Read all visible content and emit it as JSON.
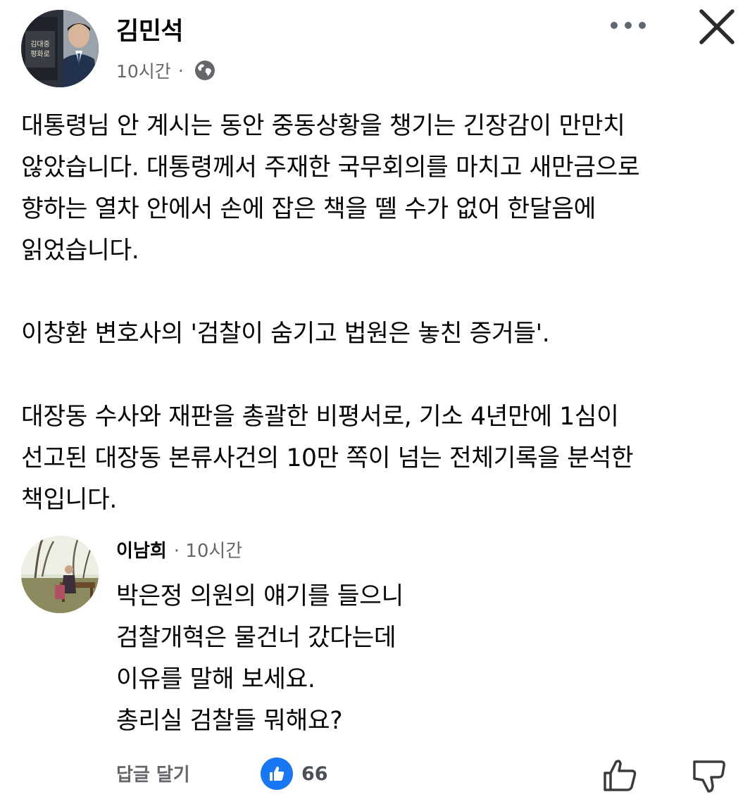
{
  "post": {
    "author": "김민석",
    "time": "10시간",
    "separator": "·",
    "privacy_icon": "globe-icon",
    "avatar_caption_line1": "김대중",
    "avatar_caption_line2": "평화로",
    "paragraphs": [
      [
        "대통령님 안 계시는 동안 중동상황을 챙기는 긴장감이 만만치",
        "않았습니다. 대통령께서 주재한 국무회의를 마치고 새만금으로",
        "향하는 열차 안에서 손에 잡은 책을 뗄 수가 없어 한달음에",
        "읽었습니다."
      ],
      [
        "이창환 변호사의 '검찰이 숨기고 법원은 놓친 증거들'."
      ],
      [
        "대장동 수사와 재판을 총괄한 비평서로, 기소 4년만에 1심이",
        "선고된 대장동 본류사건의 10만 쪽이 넘는 전체기록을 분석한",
        "책입니다."
      ]
    ]
  },
  "header_icons": {
    "more": "more-options-icon",
    "close": "close-icon"
  },
  "comment": {
    "author": "이남희",
    "time": "· 10시간",
    "lines": [
      "박은정 의원의 얘기를 들으니",
      "검찰개혁은 물건너 갔다는데",
      "이유를 말해 보세요.",
      "총리실 검찰들 뭐해요?"
    ],
    "reply_label": "답글 달기",
    "reaction_count": "66",
    "reaction_icon": "like-icon",
    "like_button_icon": "thumbs-up-icon",
    "dislike_button_icon": "thumbs-down-icon"
  },
  "colors": {
    "text": "#050505",
    "secondary_text": "#65676b",
    "like_blue": "#1877f2"
  }
}
